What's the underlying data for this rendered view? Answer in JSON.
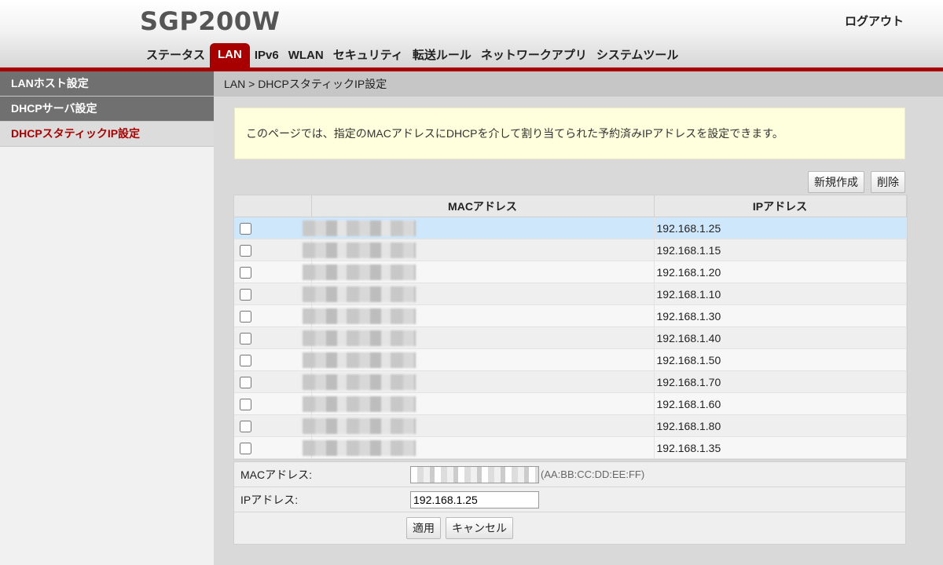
{
  "header": {
    "brand": "SGP200W",
    "logout": "ログアウト",
    "nav": [
      {
        "label": "ステータス",
        "active": false
      },
      {
        "label": "LAN",
        "active": true
      },
      {
        "label": "IPv6",
        "active": false
      },
      {
        "label": "WLAN",
        "active": false
      },
      {
        "label": "セキュリティ",
        "active": false
      },
      {
        "label": "転送ルール",
        "active": false
      },
      {
        "label": "ネットワークアプリ",
        "active": false
      },
      {
        "label": "システムツール",
        "active": false
      }
    ]
  },
  "sidebar": {
    "items": [
      {
        "label": "LANホスト設定",
        "active": false
      },
      {
        "label": "DHCPサーバ設定",
        "active": false
      },
      {
        "label": "DHCPスタティックIP設定",
        "active": true
      }
    ]
  },
  "main": {
    "breadcrumb": "LAN > DHCPスタティックIP設定",
    "info": "このページでは、指定のMACアドレスにDHCPを介して割り当てられた予約済みIPアドレスを設定できます。",
    "toolbar": {
      "new_label": "新規作成",
      "delete_label": "削除"
    },
    "table": {
      "headers": [
        "",
        "MACアドレス",
        "IPアドレス"
      ],
      "rows": [
        {
          "ip": "192.168.1.25",
          "selected": true
        },
        {
          "ip": "192.168.1.15",
          "selected": false
        },
        {
          "ip": "192.168.1.20",
          "selected": false
        },
        {
          "ip": "192.168.1.10",
          "selected": false
        },
        {
          "ip": "192.168.1.30",
          "selected": false
        },
        {
          "ip": "192.168.1.40",
          "selected": false
        },
        {
          "ip": "192.168.1.50",
          "selected": false
        },
        {
          "ip": "192.168.1.70",
          "selected": false
        },
        {
          "ip": "192.168.1.60",
          "selected": false
        },
        {
          "ip": "192.168.1.80",
          "selected": false
        },
        {
          "ip": "192.168.1.35",
          "selected": false
        }
      ]
    },
    "form": {
      "mac_label": "MACアドレス:",
      "mac_hint": "(AA:BB:CC:DD:EE:FF)",
      "ip_label": "IPアドレス:",
      "ip_value": "192.168.1.25",
      "apply_label": "適用",
      "cancel_label": "キャンセル"
    }
  },
  "colors": {
    "accent": "#a80000",
    "sidebar_bg": "#707070",
    "selected_row": "#cfe7fb",
    "info_bg": "#ffffdd"
  }
}
